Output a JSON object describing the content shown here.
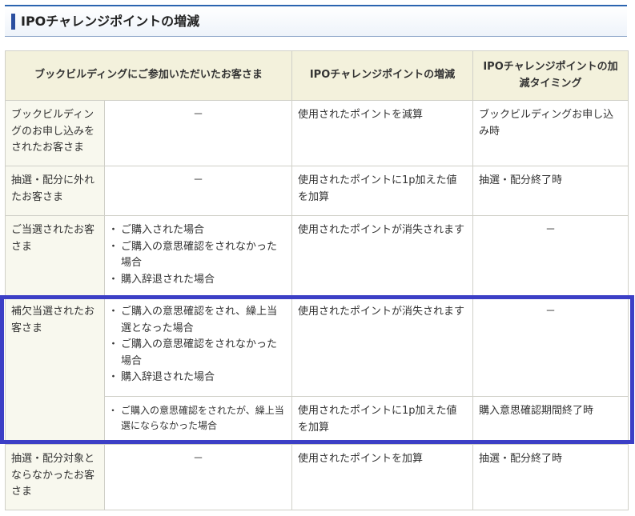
{
  "title": "IPOチャレンジポイントの増減",
  "table": {
    "headers": {
      "customer": "ブックビルディングにご参加いただいたお客さま",
      "change": "IPOチャレンジポイントの増減",
      "timing": "IPOチャレンジポイントの加減タイミング"
    },
    "rows": [
      {
        "customer": "ブックビルディングのお申し込みをされたお客さま",
        "condition": "－",
        "change": "使用されたポイントを減算",
        "timing": "ブックビルディングお申し込み時"
      },
      {
        "customer": "抽選・配分に外れたお客さま",
        "condition": "－",
        "change": "使用されたポイントに1p加えた値を加算",
        "timing": "抽選・配分終了時"
      },
      {
        "customer": "ご当選されたお客さま",
        "conditions": [
          "ご購入された場合",
          "ご購入の意思確認をされなかった場合",
          "購入辞退された場合"
        ],
        "change": "使用されたポイントが消失されます",
        "timing": "－"
      },
      {
        "customer": "補欠当選されたお客さま",
        "conditions": [
          "ご購入の意思確認をされ、繰上当選となった場合",
          "ご購入の意思確認をされなかった場合",
          "購入辞退された場合"
        ],
        "change": "使用されたポイントが消失されます",
        "timing": "－"
      },
      {
        "conditions": [
          "ご購入の意思確認をされたが、繰上当選にならなかった場合"
        ],
        "change": "使用されたポイントに1p加えた値を加算",
        "timing": "購入意思確認期間終了時"
      },
      {
        "customer": "抽選・配分対象とならなかったお客さま",
        "condition": "－",
        "change": "使用されたポイントを加算",
        "timing": "抽選・配分終了時"
      }
    ]
  },
  "highlight_color": "#3c3fc6",
  "header_bg": "#f3f1dc"
}
